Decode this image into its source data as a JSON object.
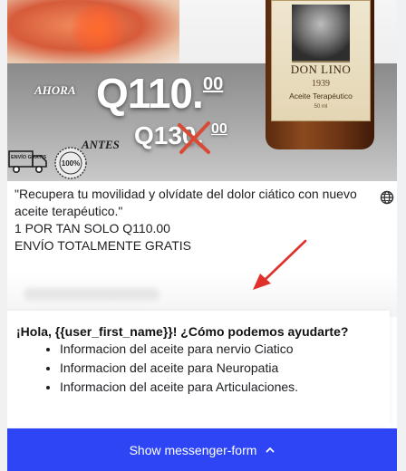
{
  "ad": {
    "ahora_label": "AHORA",
    "price_now": "Q110.",
    "price_now_cents": "00",
    "antes_label": "ANTES",
    "price_before": "Q130.",
    "price_before_cents": "00",
    "bottle": {
      "brand": "DON LINO",
      "year": "1939",
      "description": "Aceite Terapéutico",
      "volume": "50 ml"
    },
    "truck_badge": "ENVÍO GRATIS",
    "seal_badge": "100%"
  },
  "post": {
    "lines": [
      "\"Recupera tu movilidad y olvídate del dolor ciático con nuevo",
      "aceite terapéutico.\"",
      "1 POR TAN SOLO Q110.00",
      "ENVÍO TOTALMENTE GRATIS"
    ]
  },
  "messenger": {
    "greeting": "¡Hola, {{user_first_name}}! ¿Cómo podemos ayudarte?",
    "options": [
      "Informacion del aceite para nervio Ciatico",
      "Informacion del aceite para Neuropatia",
      "Informacion del aceite para Articulaciones."
    ]
  },
  "button": {
    "label": "Show messenger-form"
  },
  "colors": {
    "button_bg": "#2e45f5",
    "arrow": "#e0302a"
  }
}
